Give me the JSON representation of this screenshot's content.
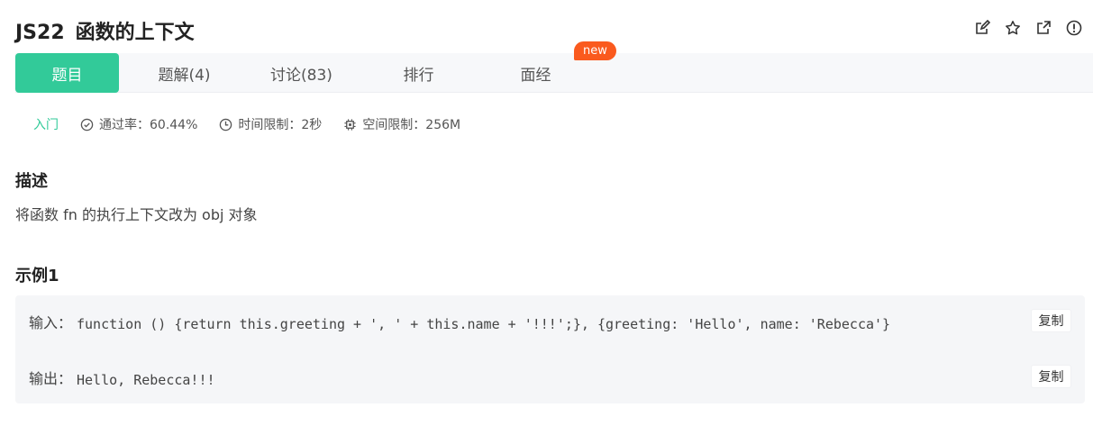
{
  "problem": {
    "code": "JS22",
    "title": "函数的上下文"
  },
  "tabs": [
    {
      "label": "题目",
      "active": true
    },
    {
      "label": "题解(4)",
      "active": false
    },
    {
      "label": "讨论(83)",
      "active": false
    },
    {
      "label": "排行",
      "active": false
    },
    {
      "label": "面经",
      "active": false
    }
  ],
  "new_badge": "new",
  "meta": {
    "level": "入门",
    "pass_rate": "通过率：60.44%",
    "time_limit": "时间限制：2秒",
    "space_limit": "空间限制：256M"
  },
  "description": {
    "heading": "描述",
    "text": "将函数 fn 的执行上下文改为 obj 对象"
  },
  "example": {
    "heading": "示例1",
    "input_label": "输入：",
    "input_value": "function () {return this.greeting + ', ' + this.name + '!!!';}, {greeting: 'Hello', name: 'Rebecca'}",
    "output_label": "输出：",
    "output_value": "Hello, Rebecca!!!",
    "copy_label": "复制"
  },
  "icons": [
    "edit-icon",
    "star-icon",
    "external-link-icon",
    "info-icon",
    "check-circle-icon",
    "clock-icon",
    "chip-icon"
  ],
  "colors": {
    "accent": "#32ca99",
    "badge": "#fa5a1e"
  }
}
